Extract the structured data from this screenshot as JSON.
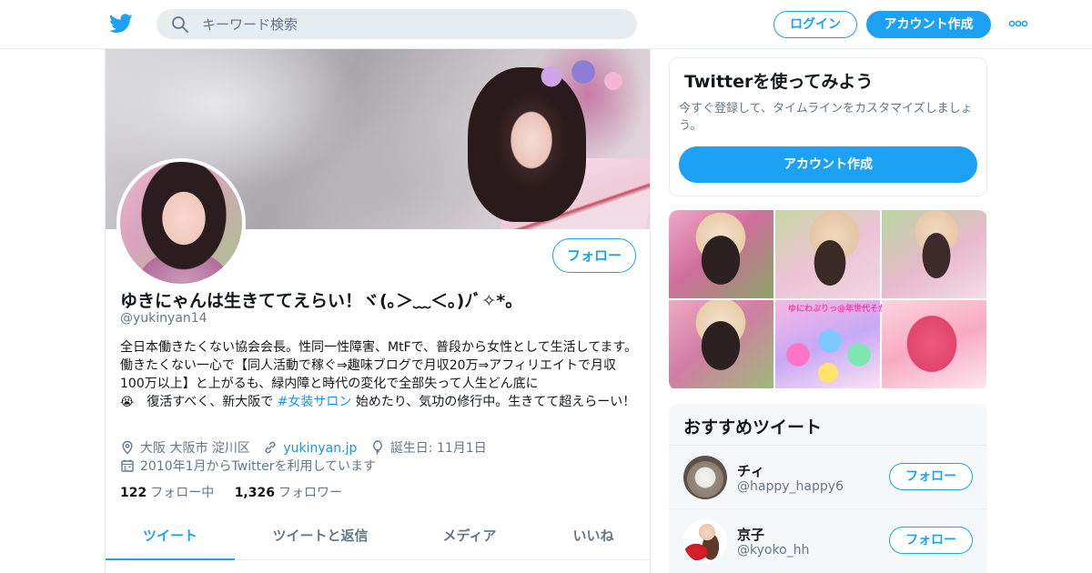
{
  "header": {
    "search_placeholder": "キーワード検索",
    "login_label": "ログイン",
    "signup_label": "アカウント作成"
  },
  "profile": {
    "follow_label": "フォロー",
    "display_name": "ゆきにゃんは生きててえらい！ヾ(｡＞﹏＜｡)ﾉﾞ✧*。",
    "screen_name": "@yukinyan14",
    "bio_part1": "全日本働きたくない協会会長。性同一性障害、MtFで、普段から女性として生活してます。働きたくない一心で【同人活動で稼ぐ⇒趣味ブログで月収20万⇒アフィリエイトで月収100万以上】と上がるも、緑内障と時代の変化で全部失って人生どん底に",
    "bio_emoji": "😭",
    "bio_part2": "　復活すべく、新大阪で ",
    "bio_hashtag": "#女装サロン",
    "bio_part3": " 始めたり、気功の修行中。生きてて超えらーい！",
    "location": "大阪 大阪市 淀川区",
    "website": "yukinyan.jp",
    "birthday": "誕生日: 11月1日",
    "joined": "2010年1月からTwitterを利用しています",
    "following_count": "122",
    "following_label": "フォロー中",
    "followers_count": "1,326",
    "followers_label": "フォロワー",
    "tabs": [
      "ツイート",
      "ツイートと返信",
      "メディア",
      "いいね"
    ]
  },
  "signup_card": {
    "title": "Twitterを使ってみよう",
    "text": "今すぐ登録して、タイムラインをカスタマイズしましょう。",
    "button_label": "アカウント作成"
  },
  "media": {
    "tile5_caption": "ゆにわぷりっ@年世代そかわいいしたゃれ♥"
  },
  "recommended": {
    "title": "おすすめツイート",
    "follow_label": "フォロー",
    "users": [
      {
        "name": "チィ",
        "handle": "@happy_happy6"
      },
      {
        "name": "京子",
        "handle": "@kyoko_hh"
      }
    ]
  },
  "colors": {
    "accent": "#1da1f2",
    "link": "#1b95e0",
    "muted": "#657786"
  },
  "icons": [
    "twitter-bird-icon",
    "search-icon",
    "more-icon",
    "location-icon",
    "link-icon",
    "balloon-icon",
    "calendar-icon"
  ]
}
